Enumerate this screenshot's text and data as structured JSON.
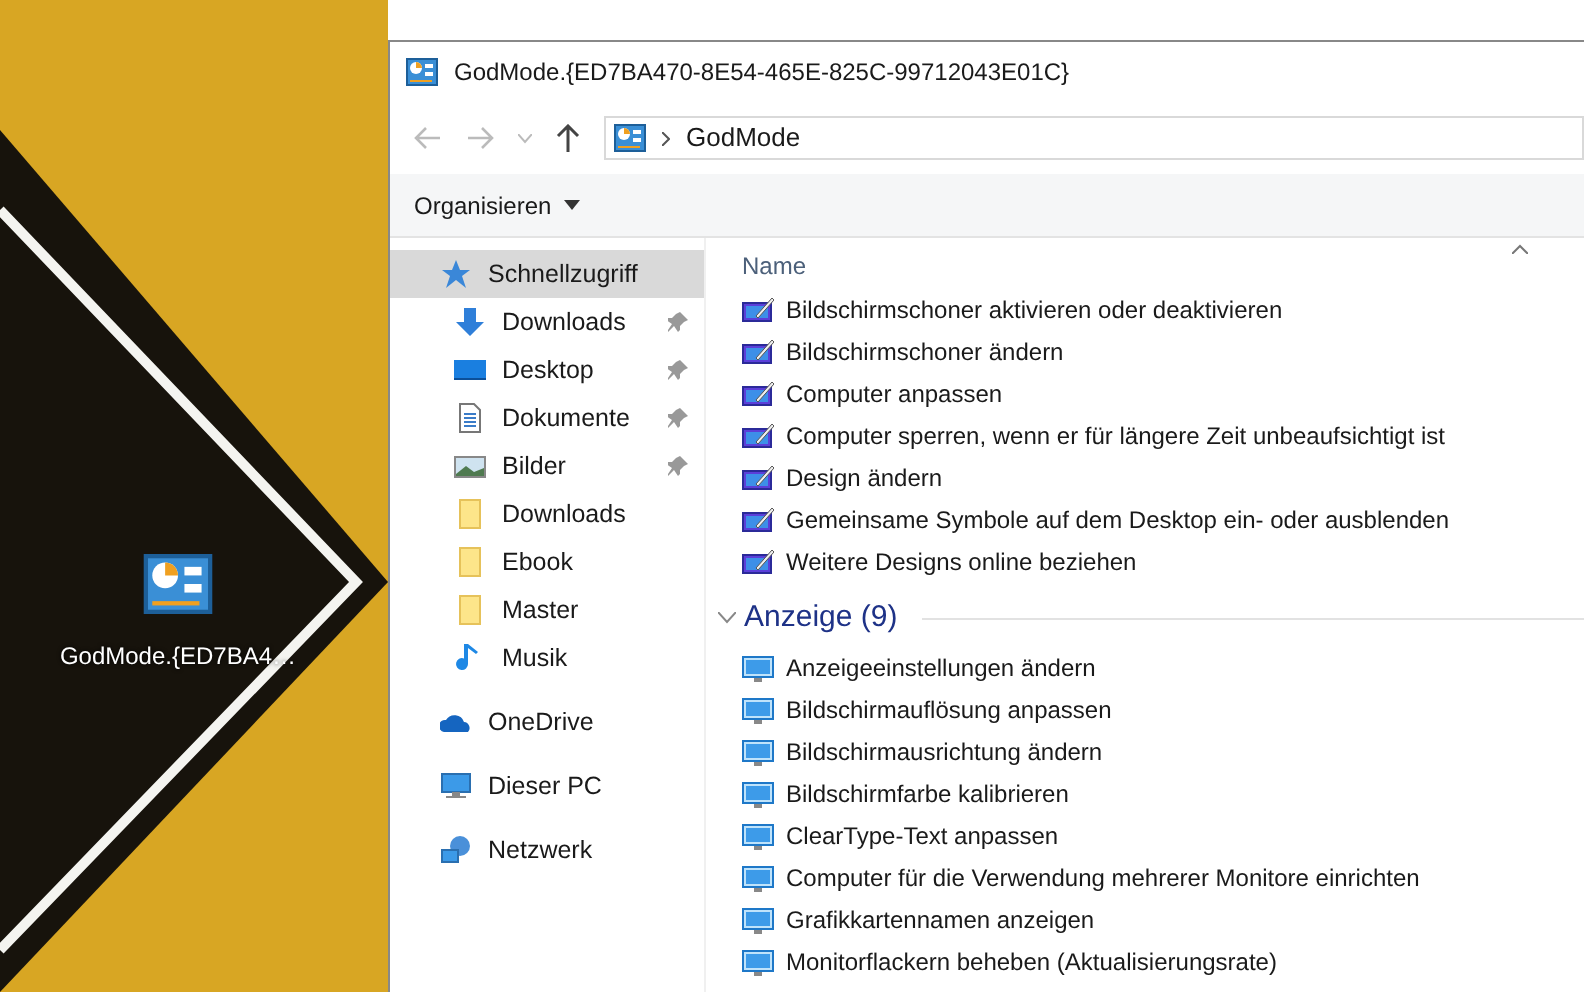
{
  "desktop": {
    "icon_label": "GodMode.{ED7BA4…",
    "icon_selected": false
  },
  "window": {
    "title": "GodMode.{ED7BA470-8E54-465E-825C-99712043E01C}"
  },
  "address_bar": {
    "path": [
      "GodMode"
    ]
  },
  "command_bar": {
    "organize": "Organisieren"
  },
  "sidebar": {
    "items": [
      {
        "label": "Schnellzugriff",
        "kind": "star",
        "selected": true,
        "children": [
          {
            "label": "Downloads",
            "kind": "download",
            "pinned": true,
            "selected": false
          },
          {
            "label": "Desktop",
            "kind": "desktop",
            "pinned": true,
            "selected": false
          },
          {
            "label": "Dokumente",
            "kind": "document",
            "pinned": true,
            "selected": false
          },
          {
            "label": "Bilder",
            "kind": "pictures",
            "pinned": true,
            "selected": false
          },
          {
            "label": "Downloads",
            "kind": "folder",
            "pinned": false,
            "selected": false
          },
          {
            "label": "Ebook",
            "kind": "folder",
            "pinned": false,
            "selected": false
          },
          {
            "label": "Master",
            "kind": "folder",
            "pinned": false,
            "selected": false
          },
          {
            "label": "Musik",
            "kind": "music",
            "pinned": false,
            "selected": false
          }
        ]
      },
      {
        "label": "OneDrive",
        "kind": "cloud",
        "selected": false
      },
      {
        "label": "Dieser PC",
        "kind": "pc",
        "selected": false
      },
      {
        "label": "Netzwerk",
        "kind": "network",
        "selected": false
      }
    ]
  },
  "content": {
    "column_header": "Name",
    "groups": [
      {
        "kind": "personalize",
        "items": [
          "Bildschirmschoner aktivieren oder deaktivieren",
          "Bildschirmschoner ändern",
          "Computer anpassen",
          "Computer sperren, wenn er für längere Zeit unbeaufsichtigt ist",
          "Design ändern",
          "Gemeinsame Symbole auf dem Desktop ein- oder ausblenden",
          "Weitere Designs online beziehen"
        ]
      },
      {
        "kind": "display",
        "title": "Anzeige (9)",
        "expanded": true,
        "items": [
          "Anzeigeeinstellungen ändern",
          "Bildschirmauflösung anpassen",
          "Bildschirmausrichtung ändern",
          "Bildschirmfarbe kalibrieren",
          "ClearType-Text anpassen",
          "Computer für die Verwendung mehrerer Monitore einrichten",
          "Grafikkartennamen anzeigen",
          "Monitorflackern beheben (Aktualisierungsrate)"
        ]
      }
    ]
  }
}
